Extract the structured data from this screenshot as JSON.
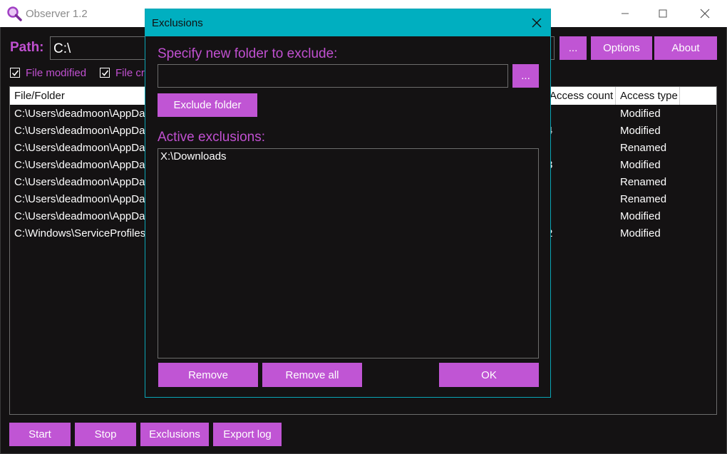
{
  "window": {
    "title": "Observer 1.2"
  },
  "toolbar": {
    "path_label": "Path:",
    "path_value": "C:\\",
    "browse_label": "...",
    "options_label": "Options",
    "about_label": "About"
  },
  "filters": [
    {
      "label": "File modified",
      "checked": true
    },
    {
      "label": "File cr",
      "checked": true
    }
  ],
  "table": {
    "columns": [
      "File/Folder",
      "Access count",
      "Access type"
    ],
    "rows": [
      {
        "path": "C:\\Users\\deadmoon\\AppDa",
        "count": "",
        "type": "Modified"
      },
      {
        "path": "C:\\Users\\deadmoon\\AppDa",
        "count": "4",
        "type": "Modified"
      },
      {
        "path": "C:\\Users\\deadmoon\\AppDa",
        "count": "",
        "type": "Renamed"
      },
      {
        "path": "C:\\Users\\deadmoon\\AppDa",
        "count": "3",
        "type": "Modified"
      },
      {
        "path": "C:\\Users\\deadmoon\\AppDa",
        "count": "",
        "type": "Renamed"
      },
      {
        "path": "C:\\Users\\deadmoon\\AppDa",
        "count": "",
        "type": "Renamed"
      },
      {
        "path": "C:\\Users\\deadmoon\\AppDa",
        "count": "",
        "type": "Modified"
      },
      {
        "path": "C:\\Windows\\ServiceProfiles",
        "count": "2",
        "type": "Modified"
      }
    ]
  },
  "bottom_bar": {
    "start_label": "Start",
    "stop_label": "Stop",
    "exclusions_label": "Exclusions",
    "export_label": "Export log"
  },
  "dialog": {
    "title": "Exclusions",
    "specify_label": "Specify new folder to exclude:",
    "folder_value": "",
    "browse_label": "...",
    "exclude_button": "Exclude folder",
    "active_label": "Active exclusions:",
    "exclusions": [
      "X:\\Downloads"
    ],
    "remove_label": "Remove",
    "remove_all_label": "Remove all",
    "ok_label": "OK"
  },
  "colors": {
    "accent": "#c055d4",
    "dialog_title": "#00afc0",
    "background": "#141213"
  }
}
